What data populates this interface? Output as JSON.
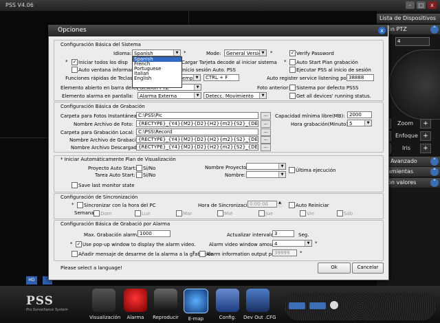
{
  "app": {
    "title": "PSS  V4.06",
    "win_min": "-",
    "win_max": "□",
    "win_close": "x"
  },
  "right_panel": {
    "device_list": "Lista de Dispositivos",
    "ptz": "ón PTZ",
    "ptz_value": "4",
    "zoom": "Zoom",
    "focus": "Enfoque",
    "iris": "Iris",
    "minus": "-",
    "plus": "+",
    "advanced": "Avanzado",
    "tools": "amientas",
    "color": "ón valores"
  },
  "bottom": {
    "logo": "PSS",
    "logo_sub": "Pro Surveillance System",
    "hd": "HD",
    "buttons": [
      "Visualización",
      "Alarma",
      "Reproducir",
      "E-map",
      "Config.",
      "Dev Out .CFG"
    ]
  },
  "dialog": {
    "title": "Opciones",
    "close": "x",
    "status": "Please select a language!",
    "ok": "Ok",
    "cancel": "Cancelar",
    "basic": {
      "title": "Configuración Básica del Sistema",
      "idioma_label": "Idioma:",
      "idioma_value": "Spanish",
      "languages": [
        "Spanish",
        "French",
        "Portuguese",
        "Italian",
        "English"
      ],
      "mode_label": "Mode:",
      "mode_value": "General Version",
      "verify_password": "Verify Password",
      "start_all": "Iniciar todos los disp",
      "load_card": "Cargar Tarjeta decode al iniciar sistema",
      "auto_start_plan": "Auto Start Plan grabación",
      "auto_window": "Auto ventana información",
      "auto_login": "Inicio sesión Auto. PSS",
      "exec_pss": "Ejecutar PSS al inicio de sesión",
      "hotkeys_label": "Funciones rápidas de Teclas:",
      "hotkeys_combo": "empo i",
      "hotkeys_value": "CTRL + F",
      "auto_register": "Auto register service listening port:",
      "register_port": "38888",
      "open_bar_label": "Elemento abierto en barra derec...",
      "open_bar_value": "Gestión PTZ",
      "foto_anterior": "Foto anterior:",
      "default_pss": "Sistema por defecto PSSS",
      "alarm_screen_label": "Elemento alarma en pantalla:",
      "alarm_screen_value": "Alarma Externa",
      "motion_value": "Detecc. Movimiento",
      "get_status": "Get all devices' running status."
    },
    "record": {
      "title": "Configuración Básica de Grabación",
      "snapshot_label": "Carpeta para Fotos Instantáneas:",
      "snapshot_path": "C:\\PSS\\Pic",
      "photo_name_label": "Nombre Archivo de Foto:",
      "photo_name_value": "{RECTYPE}_{Y4}{M2}{D2}{H2}{m2}{S2}_{DEVID}_{CHN}",
      "local_label": "Carpeta para Grabación Local:",
      "local_path": "C:\\PSS\\Record",
      "rec_name_label": "Nombre Archivo de Grabación:",
      "rec_name_value": "{RECTYPE}_{Y4}{M2}{D2}{H2}{m2}{S2}_{DEVID}_{CHN}",
      "down_name_label": "Nombre Archivo Descargado:",
      "down_name_value": "{RECTYPE}_{Y4}{M2}{D2}{H2}{m2}{S2}_{DEVID}_{CHN}",
      "browse": "...",
      "min_cap_label": "Capacidad mínima libre(MB):",
      "min_cap_value": "2000",
      "rec_time_label": "Hora grabación(Minuto):",
      "rec_time_value": "5"
    },
    "plan": {
      "title": "* Iniciar Automáticamente Plan de Visualización",
      "project_auto_label": "Proyecto Auto Start:",
      "yes_no": "Sí/No",
      "task_auto_label": "Tarea Auto Start:",
      "project_name_label": "Nombre Proyecto:",
      "name_label": "Nombre:",
      "last_exec": "Última ejecución",
      "save_last": "Save last monitor state"
    },
    "sync": {
      "title": "Configuración de Sincronización",
      "sync_pc": "Sincronizar con la hora del PC",
      "sync_time_label": "Hora de Sincronización",
      "sync_time_value": "0:00:00",
      "auto_restart": "Auto Reiniciar",
      "week_label": "Semana",
      "days": [
        "Dom",
        "Lun",
        "Mar",
        "Mié",
        "Jue",
        "Vie",
        "Sáb"
      ]
    },
    "alarm": {
      "title": "Configuración Básica de Grabació por Alarma",
      "max_label": "Max. Grabación alarma:",
      "max_value": "1000",
      "update_label": "Actualizar intervalo:",
      "update_value": "3",
      "update_unit": "Seg.",
      "popup": "Use pop-up window to display the alarm video.",
      "window_amount_label": "Alarm video window amount:",
      "window_amount_value": "4",
      "add_msg": "Añadir mensaje de desarme de la alarma a la grabación",
      "info_port": "Alarm information output port:",
      "info_port_value": "39999",
      "star": "*"
    }
  }
}
